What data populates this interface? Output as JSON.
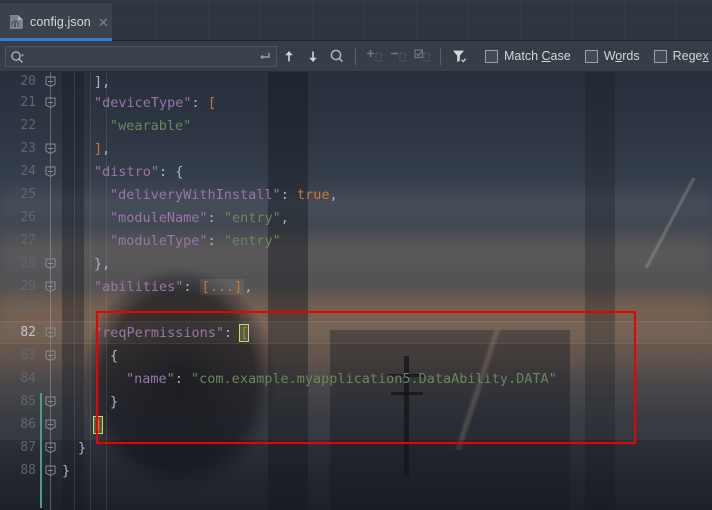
{
  "window": {
    "tab": {
      "label": "config.json",
      "icon": "json-file-icon",
      "close_icon": "close-icon",
      "active": true
    }
  },
  "findbar": {
    "search": {
      "value": "",
      "placeholder": "",
      "icon": "search-icon",
      "dropdown_icon": "chevron-down-icon",
      "return_icon": "return-arrow-icon"
    },
    "buttons": [
      {
        "name": "find-previous-button",
        "icon": "arrow-up-icon",
        "enabled": true
      },
      {
        "name": "find-next-button",
        "icon": "arrow-down-icon",
        "enabled": true
      },
      {
        "name": "select-all-occurrences-button",
        "icon": "magnifier-select-icon",
        "enabled": true
      },
      {
        "name": "add-selection-button",
        "icon": "add-selection-icon",
        "enabled": false
      },
      {
        "name": "remove-selection-button",
        "icon": "remove-selection-icon",
        "enabled": false
      },
      {
        "name": "select-occurrences-button",
        "icon": "check-selection-icon",
        "enabled": false
      },
      {
        "name": "filter-button",
        "icon": "filter-funnel-icon",
        "enabled": true
      }
    ],
    "checkboxes": [
      {
        "name": "match-case-checkbox",
        "label": "Match Case",
        "mnemonic": "C",
        "checked": false
      },
      {
        "name": "words-checkbox",
        "label": "Words",
        "mnemonic": "o",
        "checked": false
      },
      {
        "name": "regex-checkbox",
        "label": "Regex",
        "mnemonic": "x",
        "checked": false
      }
    ]
  },
  "editor": {
    "language": "json",
    "current_line": 82,
    "caret": {
      "line": 82,
      "after": "["
    },
    "colors": {
      "key": "#9876AA",
      "string": "#6A8759",
      "boolean": "#CC7832",
      "punctuation": "#A9B7C6",
      "line_number": "#5E6672",
      "annotation": "#EE0000",
      "change_marker": "#4F9C8A",
      "tab_accent": "#2F7FE0"
    },
    "lines": [
      {
        "num": 20,
        "indent": 2,
        "fold": "minus",
        "partial": true,
        "tokens": [
          {
            "t": "],",
            "c": "p"
          }
        ]
      },
      {
        "num": 21,
        "indent": 2,
        "fold": "minus",
        "tokens": [
          {
            "t": "\"deviceType\"",
            "c": "k"
          },
          {
            "t": ": ",
            "c": "p"
          },
          {
            "t": "[",
            "c": "br"
          }
        ]
      },
      {
        "num": 22,
        "indent": 3,
        "fold": "none",
        "tokens": [
          {
            "t": "\"wearable\"",
            "c": "s"
          }
        ]
      },
      {
        "num": 23,
        "indent": 2,
        "fold": "minus",
        "tokens": [
          {
            "t": "]",
            "c": "br"
          },
          {
            "t": ",",
            "c": "p"
          }
        ]
      },
      {
        "num": 24,
        "indent": 2,
        "fold": "minus",
        "tokens": [
          {
            "t": "\"distro\"",
            "c": "k"
          },
          {
            "t": ": ",
            "c": "p"
          },
          {
            "t": "{",
            "c": "bq"
          }
        ]
      },
      {
        "num": 25,
        "indent": 3,
        "fold": "none",
        "tokens": [
          {
            "t": "\"deliveryWithInstall\"",
            "c": "k"
          },
          {
            "t": ": ",
            "c": "p"
          },
          {
            "t": "true",
            "c": "b"
          },
          {
            "t": ",",
            "c": "p"
          }
        ]
      },
      {
        "num": 26,
        "indent": 3,
        "fold": "none",
        "tokens": [
          {
            "t": "\"moduleName\"",
            "c": "k"
          },
          {
            "t": ": ",
            "c": "p"
          },
          {
            "t": "\"entry\"",
            "c": "s"
          },
          {
            "t": ",",
            "c": "p"
          }
        ]
      },
      {
        "num": 27,
        "indent": 3,
        "fold": "none",
        "tokens": [
          {
            "t": "\"moduleType\"",
            "c": "k"
          },
          {
            "t": ": ",
            "c": "p"
          },
          {
            "t": "\"entry\"",
            "c": "s"
          }
        ]
      },
      {
        "num": 28,
        "indent": 2,
        "fold": "minus",
        "tokens": [
          {
            "t": "}",
            "c": "bq"
          },
          {
            "t": ",",
            "c": "p"
          }
        ]
      },
      {
        "num": 29,
        "indent": 2,
        "fold": "plus",
        "tokens": [
          {
            "t": "\"abilities\"",
            "c": "k"
          },
          {
            "t": ": ",
            "c": "p"
          },
          {
            "t": "[...]",
            "c": "fold-chip"
          },
          {
            "t": ",",
            "c": "p"
          }
        ]
      },
      {
        "num": 81,
        "indent": 0,
        "fold": "none",
        "tokens": []
      },
      {
        "num": 82,
        "indent": 2,
        "fold": "minus",
        "current": true,
        "tokens": [
          {
            "t": "\"reqPermissions\"",
            "c": "k"
          },
          {
            "t": ": ",
            "c": "p"
          },
          {
            "t": "[",
            "c": "match-hl"
          }
        ]
      },
      {
        "num": 83,
        "indent": 3,
        "fold": "minus",
        "tokens": [
          {
            "t": "{",
            "c": "bq"
          }
        ]
      },
      {
        "num": 84,
        "indent": 4,
        "fold": "none",
        "tokens": [
          {
            "t": "\"name\"",
            "c": "k"
          },
          {
            "t": ": ",
            "c": "p"
          },
          {
            "t": "\"com.example.myapplication5.DataAbility.DATA\"",
            "c": "s"
          }
        ]
      },
      {
        "num": 85,
        "indent": 3,
        "fold": "minus",
        "tokens": [
          {
            "t": "}",
            "c": "bq"
          }
        ]
      },
      {
        "num": 86,
        "indent": 2,
        "fold": "minus",
        "tokens": [
          {
            "t": "]",
            "c": "match-hl"
          }
        ]
      },
      {
        "num": 87,
        "indent": 1,
        "fold": "minus",
        "tokens": [
          {
            "t": "}",
            "c": "bq"
          }
        ]
      },
      {
        "num": 88,
        "indent": 0,
        "fold": "minus",
        "tokens": [
          {
            "t": "}",
            "c": "bq"
          }
        ]
      }
    ]
  },
  "annotation": {
    "name": "red-highlight-rectangle",
    "color": "#EE0000",
    "covers_lines": [
      82,
      86
    ]
  }
}
